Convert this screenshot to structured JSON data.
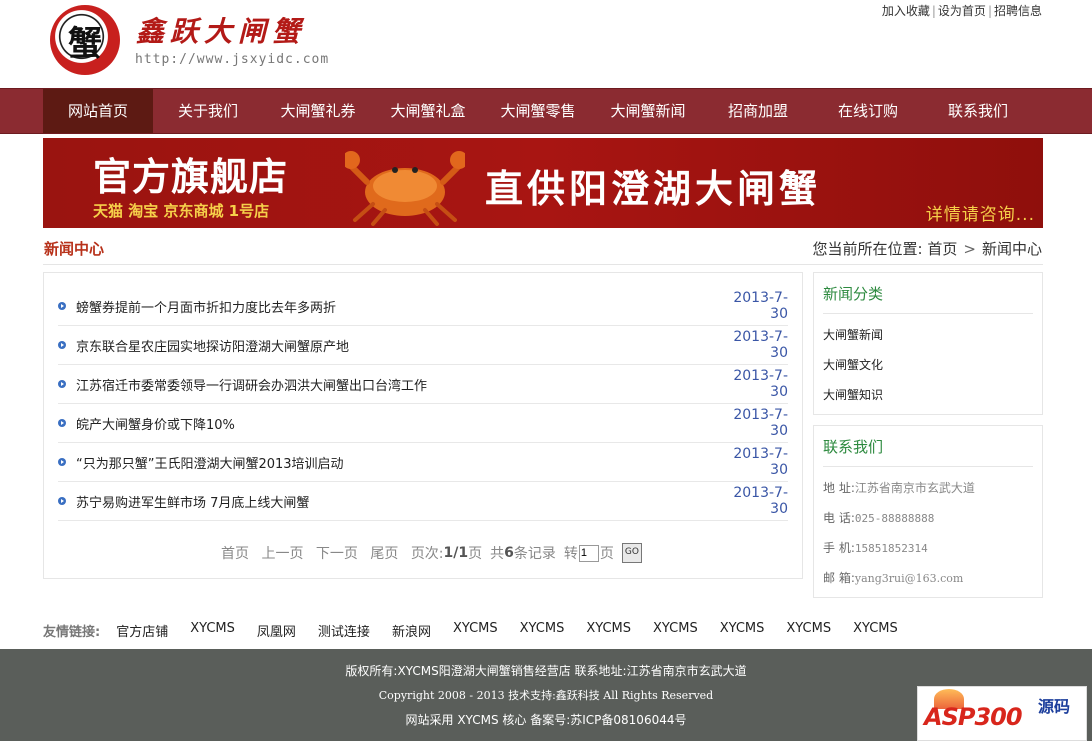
{
  "header": {
    "seal_char": "蟹",
    "brand_name": "鑫跃大闸蟹",
    "url": "http://www.jsxyidc.com",
    "top_links": [
      "加入收藏",
      "设为首页",
      "招聘信息"
    ]
  },
  "nav": {
    "items": [
      "网站首页",
      "关于我们",
      "大闸蟹礼券",
      "大闸蟹礼盒",
      "大闸蟹零售",
      "大闸蟹新闻",
      "招商加盟",
      "在线订购",
      "联系我们"
    ],
    "active_index": 0
  },
  "banner": {
    "title": "官方旗舰店",
    "shops": "天猫 淘宝 京东商城 1号店",
    "slogan": "直供阳澄湖大闸蟹",
    "more": "详情请咨询..."
  },
  "section": {
    "title": "新闻中心",
    "breadcrumb_prefix": "您当前所在位置:",
    "breadcrumb": [
      "首页",
      "新闻中心"
    ]
  },
  "news": [
    {
      "title": "螃蟹券提前一个月面市折扣力度比去年多两折",
      "date": "2013-7-30"
    },
    {
      "title": "京东联合星农庄园实地探访阳澄湖大闸蟹原产地",
      "date": "2013-7-30"
    },
    {
      "title": "江苏宿迁市委常委领导一行调研会办泗洪大闸蟹出口台湾工作",
      "date": "2013-7-30"
    },
    {
      "title": "皖产大闸蟹身价或下降10%",
      "date": "2013-7-30"
    },
    {
      "title": "“只为那只蟹”王氏阳澄湖大闸蟹2013培训启动",
      "date": "2013-7-30"
    },
    {
      "title": "苏宁易购进军生鲜市场 7月底上线大闸蟹",
      "date": "2013-7-30"
    }
  ],
  "pager": {
    "first": "首页",
    "prev": "上一页",
    "next": "下一页",
    "last": "尾页",
    "page_label": "页次:",
    "page_value": "1/1",
    "page_unit": "页",
    "total_prefix": "共",
    "total_count": "6",
    "total_suffix": "条记录",
    "goto_label": "转",
    "goto_value": "1",
    "goto_unit": "页",
    "go_button": "GO"
  },
  "sidebar": {
    "categories": {
      "title": "新闻分类",
      "items": [
        "大闸蟹新闻",
        "大闸蟹文化",
        "大闸蟹知识"
      ]
    },
    "contact": {
      "title": "联系我们",
      "rows": [
        {
          "label": "地 址:",
          "value": "江苏省南京市玄武大道"
        },
        {
          "label": "电 话:",
          "value": "025-88888888"
        },
        {
          "label": "手 机:",
          "value": "15851852314"
        },
        {
          "label": "邮 箱:",
          "value": "yang3rui@163.com"
        }
      ]
    }
  },
  "friend_links": {
    "label": "友情链接:",
    "items": [
      "官方店铺",
      "XYCMS",
      "凤凰网",
      "测试连接",
      "新浪网",
      "XYCMS",
      "XYCMS",
      "XYCMS",
      "XYCMS",
      "XYCMS",
      "XYCMS",
      "XYCMS"
    ]
  },
  "footer": {
    "line1": "版权所有:XYCMS阳澄湖大闸蟹销售经营店   联系地址:江苏省南京市玄武大道",
    "line2": "Copyright 2008 - 2013    技术支持:鑫跃科技 All Rights Reserved",
    "line3": "网站采用 XYCMS 核心 备案号:苏ICP备08106044号"
  },
  "watermark": {
    "text1": "ASP300",
    "text2": "源码"
  },
  "colors": {
    "nav_bg": "#8b2b31",
    "nav_active": "#5d1a13",
    "banner_bg": "#a81512",
    "section_title": "#b8321b",
    "sidebar_title": "#2d8a3f",
    "date": "#3a56a6",
    "footer_bg": "#5a5e5a"
  }
}
